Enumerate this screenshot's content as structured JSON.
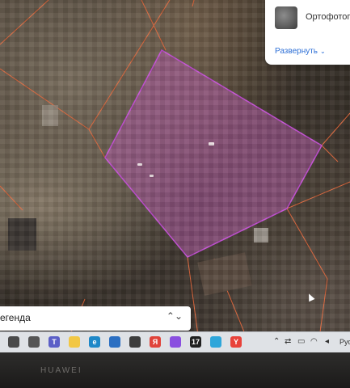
{
  "map": {
    "plot_fill": "#b15aa6",
    "plot_stroke": "#c64fd8",
    "boundary_color": "#e2683c"
  },
  "layer_panel": {
    "layer_name": "Ортофотопл",
    "expand_label": "Развернуть",
    "expand_chevron": "⌄"
  },
  "legend": {
    "label": "егенда",
    "toggle_icon": "⌃⌄"
  },
  "taskbar": {
    "apps": [
      {
        "icon": "windows-start-icon",
        "glyph": "",
        "color": "#4a4a4a"
      },
      {
        "icon": "task-view-icon",
        "glyph": "",
        "color": "#555555"
      },
      {
        "icon": "teams-icon",
        "glyph": "T",
        "color": "#5b5fc7"
      },
      {
        "icon": "file-explorer-icon",
        "glyph": "",
        "color": "#f2c744"
      },
      {
        "icon": "edge-icon",
        "glyph": "e",
        "color": "#1e88c8"
      },
      {
        "icon": "store-icon",
        "glyph": "",
        "color": "#2b6fc2"
      },
      {
        "icon": "app-icon",
        "glyph": "",
        "color": "#3d3d3d"
      },
      {
        "icon": "yandex-icon",
        "glyph": "Я",
        "color": "#e0433a"
      },
      {
        "icon": "alice-icon",
        "glyph": "",
        "color": "#8a4fe0"
      },
      {
        "icon": "tinkoff-icon",
        "glyph": "17",
        "color": "#1f1f1f"
      },
      {
        "icon": "telegram-icon",
        "glyph": "",
        "color": "#2ea6da"
      },
      {
        "icon": "yandex-browser-icon",
        "glyph": "Y",
        "color": "#e8423a"
      }
    ],
    "tray": {
      "chevron": "⌃",
      "settings_icon": "⇄",
      "battery_icon": "▭",
      "wifi_icon": "◠",
      "volume_icon": "◂",
      "language": "Рус"
    }
  },
  "device": {
    "brand": "HUAWEI"
  }
}
